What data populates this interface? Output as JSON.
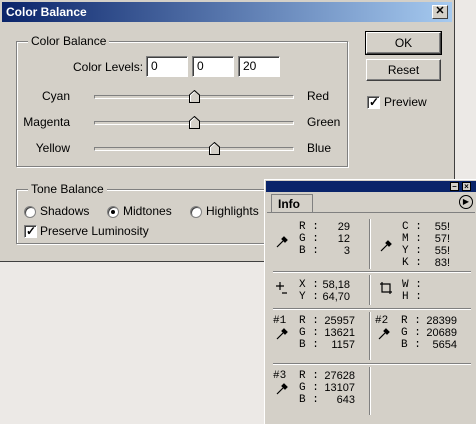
{
  "dialog": {
    "title": "Color Balance",
    "close_glyph": "✕",
    "color_balance": {
      "legend": "Color Balance",
      "levels_label": "Color Levels:",
      "levels": [
        "0",
        "0",
        "20"
      ],
      "sliders": [
        {
          "left": "Cyan",
          "right": "Red",
          "value": 0
        },
        {
          "left": "Magenta",
          "right": "Green",
          "value": 0
        },
        {
          "left": "Yellow",
          "right": "Blue",
          "value": 20
        }
      ],
      "slider_range": [
        -100,
        100
      ]
    },
    "tone_balance": {
      "legend": "Tone Balance",
      "options": [
        "Shadows",
        "Midtones",
        "Highlights"
      ],
      "selected": "Midtones",
      "preserve_label": "Preserve Luminosity",
      "preserve_checked": true
    },
    "buttons": {
      "ok": "OK",
      "reset": "Reset"
    },
    "preview_label": "Preview",
    "preview_checked": true
  },
  "info": {
    "tab": "Info",
    "menu_glyph": "▶",
    "rgb": {
      "labels": [
        "R :",
        "G :",
        "B :"
      ],
      "values": [
        "29",
        "12",
        "3"
      ]
    },
    "cmyk": {
      "labels": [
        "C :",
        "M :",
        "Y :",
        "K :"
      ],
      "values": [
        "55!",
        "57!",
        "55!",
        "83!"
      ]
    },
    "xy": {
      "labels": [
        "X :",
        "Y :"
      ],
      "values": [
        "58,18",
        "64,70"
      ]
    },
    "wh": {
      "labels": [
        "W :",
        "H :"
      ],
      "values": [
        "",
        ""
      ]
    },
    "samplers": [
      {
        "id": "#1",
        "labels": [
          "R :",
          "G :",
          "B :"
        ],
        "values": [
          "25957",
          "13621",
          "1157"
        ]
      },
      {
        "id": "#2",
        "labels": [
          "R :",
          "G :",
          "B :"
        ],
        "values": [
          "28399",
          "20689",
          "5654"
        ]
      },
      {
        "id": "#3",
        "labels": [
          "R :",
          "G :",
          "B :"
        ],
        "values": [
          "27628",
          "13107",
          "643"
        ]
      }
    ]
  },
  "colors": {
    "titlebar": "#0a246a",
    "face": "#d4d0c8"
  }
}
